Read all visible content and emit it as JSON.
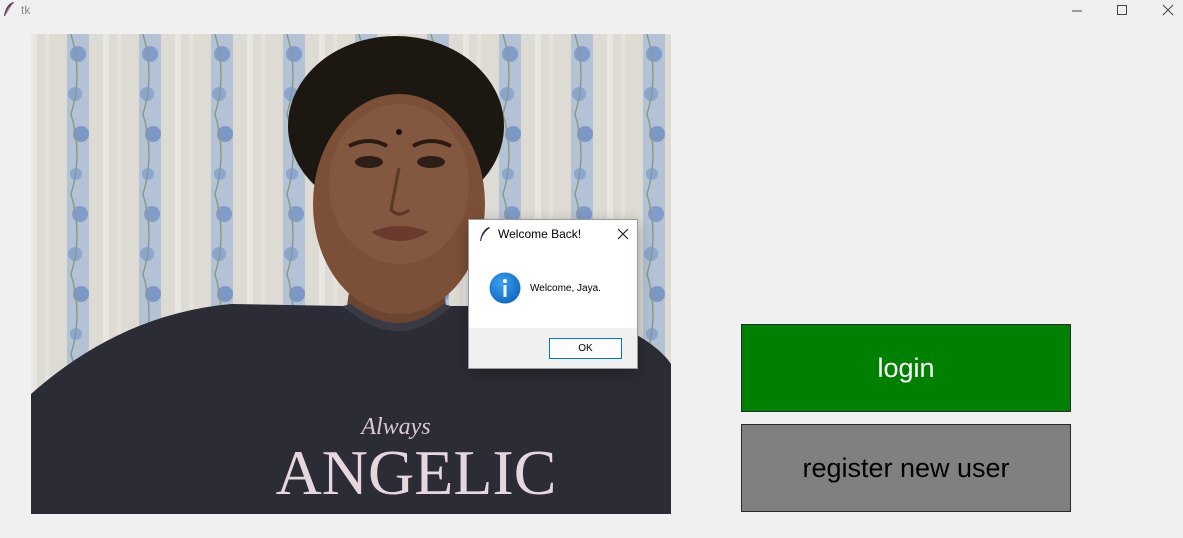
{
  "window": {
    "title": "tk",
    "icon": "feather-icon",
    "controls": [
      "minimize-icon",
      "maximize-icon",
      "close-icon"
    ]
  },
  "camera_feed": {
    "shirt_text_script": "Always",
    "shirt_text_main": "ANGELIC"
  },
  "buttons": {
    "login_label": "login",
    "register_label": "register new user"
  },
  "dialog": {
    "title": "Welcome Back!",
    "message": "Welcome, Jaya.",
    "ok_label": "OK",
    "icon": "info-icon"
  },
  "colors": {
    "login_bg": "#008000",
    "register_bg": "#808080",
    "window_bg": "#f0f0f0",
    "ok_border": "#0078d4",
    "info_blue": "#1a7fd4"
  }
}
